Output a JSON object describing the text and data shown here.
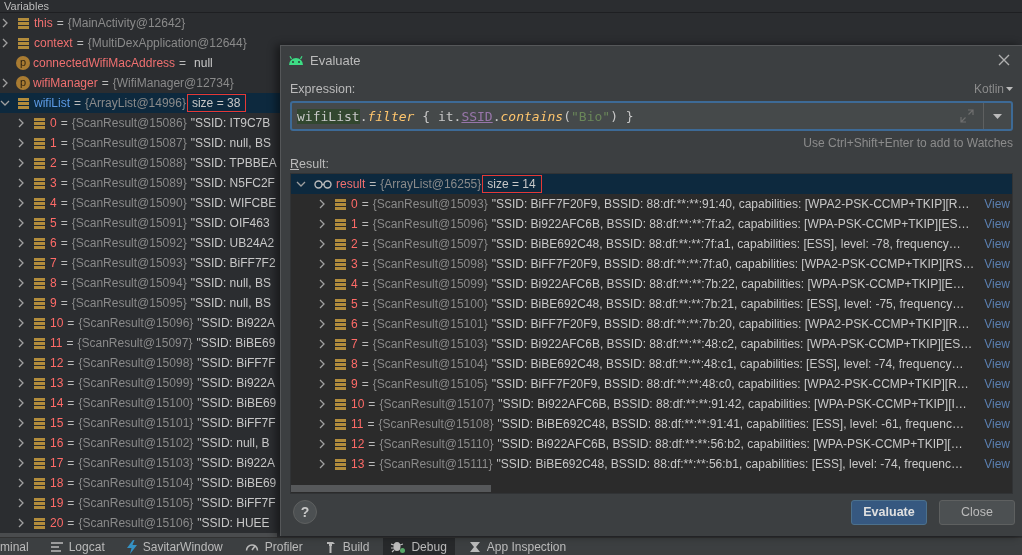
{
  "panel": {
    "title": "Variables"
  },
  "variables": [
    {
      "kind": "field",
      "name": "this",
      "op": "=",
      "type_label": "{MainActivity@12642}",
      "changed": false,
      "expanded": false,
      "selected": false
    },
    {
      "kind": "field",
      "name": "context",
      "op": "=",
      "type_label": "{MultiDexApplication@12644}",
      "changed": false,
      "expanded": false,
      "selected": false
    },
    {
      "kind": "property",
      "icon_letter": "p",
      "name": "connectedWifiMacAddress",
      "op": "=",
      "value": "null",
      "changed": false,
      "selected": false
    },
    {
      "kind": "property",
      "icon_letter": "p",
      "name": "wifiManager",
      "op": "=",
      "type_label": "{WifiManager@12734}",
      "changed": false,
      "expanded": false,
      "selected": false
    },
    {
      "kind": "field",
      "name": "wifiList",
      "op": "=",
      "type_label": "{ArrayList@14996}",
      "size": "size = 38",
      "annotated": true,
      "changed": true,
      "expanded": true,
      "selected": true,
      "children": [
        {
          "kind": "field",
          "name": "0",
          "op": "=",
          "type_label": "{ScanResult@15086}",
          "value": "\"SSID: IT9C7B",
          "expanded": false,
          "selected": false
        },
        {
          "kind": "field",
          "name": "1",
          "op": "=",
          "type_label": "{ScanResult@15087}",
          "value": "\"SSID: null, BS",
          "expanded": false,
          "selected": false
        },
        {
          "kind": "field",
          "name": "2",
          "op": "=",
          "type_label": "{ScanResult@15088}",
          "value": "\"SSID: TPBBEA",
          "expanded": false,
          "selected": false
        },
        {
          "kind": "field",
          "name": "3",
          "op": "=",
          "type_label": "{ScanResult@15089}",
          "value": "\"SSID: N5FC2F",
          "expanded": false,
          "selected": false
        },
        {
          "kind": "field",
          "name": "4",
          "op": "=",
          "type_label": "{ScanResult@15090}",
          "value": "\"SSID: WIFCBE",
          "expanded": false,
          "selected": false
        },
        {
          "kind": "field",
          "name": "5",
          "op": "=",
          "type_label": "{ScanResult@15091}",
          "value": "\"SSID: OIF463",
          "expanded": false,
          "selected": false
        },
        {
          "kind": "field",
          "name": "6",
          "op": "=",
          "type_label": "{ScanResult@15092}",
          "value": "\"SSID: UB24A2",
          "expanded": false,
          "selected": false
        },
        {
          "kind": "field",
          "name": "7",
          "op": "=",
          "type_label": "{ScanResult@15093}",
          "value": "\"SSID: BiFF7F2",
          "expanded": false,
          "selected": false
        },
        {
          "kind": "field",
          "name": "8",
          "op": "=",
          "type_label": "{ScanResult@15094}",
          "value": "\"SSID: null, BS",
          "expanded": false,
          "selected": false
        },
        {
          "kind": "field",
          "name": "9",
          "op": "=",
          "type_label": "{ScanResult@15095}",
          "value": "\"SSID: null, BS",
          "expanded": false,
          "selected": false
        },
        {
          "kind": "field",
          "name": "10",
          "op": "=",
          "type_label": "{ScanResult@15096}",
          "value": "\"SSID: Bi922A",
          "expanded": false,
          "selected": false
        },
        {
          "kind": "field",
          "name": "11",
          "op": "=",
          "type_label": "{ScanResult@15097}",
          "value": "\"SSID: BiBE69",
          "expanded": false,
          "selected": false
        },
        {
          "kind": "field",
          "name": "12",
          "op": "=",
          "type_label": "{ScanResult@15098}",
          "value": "\"SSID: BiFF7F",
          "expanded": false,
          "selected": false
        },
        {
          "kind": "field",
          "name": "13",
          "op": "=",
          "type_label": "{ScanResult@15099}",
          "value": "\"SSID: Bi922A",
          "expanded": false,
          "selected": false
        },
        {
          "kind": "field",
          "name": "14",
          "op": "=",
          "type_label": "{ScanResult@15100}",
          "value": "\"SSID: BiBE69",
          "expanded": false,
          "selected": false
        },
        {
          "kind": "field",
          "name": "15",
          "op": "=",
          "type_label": "{ScanResult@15101}",
          "value": "\"SSID: BiFF7F",
          "expanded": false,
          "selected": false
        },
        {
          "kind": "field",
          "name": "16",
          "op": "=",
          "type_label": "{ScanResult@15102}",
          "value": "\"SSID: null, B",
          "expanded": false,
          "selected": false
        },
        {
          "kind": "field",
          "name": "17",
          "op": "=",
          "type_label": "{ScanResult@15103}",
          "value": "\"SSID: Bi922A",
          "expanded": false,
          "selected": false
        },
        {
          "kind": "field",
          "name": "18",
          "op": "=",
          "type_label": "{ScanResult@15104}",
          "value": "\"SSID: BiBE69",
          "expanded": false,
          "selected": false
        },
        {
          "kind": "field",
          "name": "19",
          "op": "=",
          "type_label": "{ScanResult@15105}",
          "value": "\"SSID: BiFF7F",
          "expanded": false,
          "selected": false
        },
        {
          "kind": "field",
          "name": "20",
          "op": "=",
          "type_label": "{ScanResult@15106}",
          "value": "\"SSID: HUEE",
          "expanded": false,
          "selected": false
        }
      ]
    }
  ],
  "dialog": {
    "title": "Evaluate",
    "expression_label": "Expression:",
    "language": "Kotlin",
    "expression": [
      {
        "text": "wifiList",
        "kind": "highlight"
      },
      {
        "text": ".",
        "kind": "plain"
      },
      {
        "text": "filter",
        "kind": "function"
      },
      {
        "text": " { it.",
        "kind": "plain"
      },
      {
        "text": "SSID",
        "kind": "property"
      },
      {
        "text": ".",
        "kind": "plain"
      },
      {
        "text": "contains",
        "kind": "function"
      },
      {
        "text": "(",
        "kind": "plain"
      },
      {
        "text": "\"Bio\"",
        "kind": "string"
      },
      {
        "text": ") }",
        "kind": "plain"
      }
    ],
    "hint": "Use Ctrl+Shift+Enter to add to Watches",
    "result_label": "Result:",
    "result_label_mnemonic": true,
    "result": {
      "kind": "watch",
      "name": "result",
      "op": "=",
      "type_label": "{ArrayList@16255}",
      "size": "size = 14",
      "annotated": true,
      "expanded": true,
      "selected": true,
      "children": [
        {
          "kind": "field",
          "name": "0",
          "op": "=",
          "type_label": "{ScanResult@15093}",
          "value": "\"SSID: BiFF7F20F9, BSSID: 88:df:**:**:91:40, capabilities: [WPA2-PSK-CCMP+TKIP][R…",
          "link": "View",
          "expanded": false,
          "selected": false
        },
        {
          "kind": "field",
          "name": "1",
          "op": "=",
          "type_label": "{ScanResult@15096}",
          "value": "\"SSID: Bi922AFC6B, BSSID: 88:df:**:**:7f:a2, capabilities: [WPA-PSK-CCMP+TKIP][ES…",
          "link": "View",
          "expanded": false,
          "selected": false
        },
        {
          "kind": "field",
          "name": "2",
          "op": "=",
          "type_label": "{ScanResult@15097}",
          "value": "\"SSID: BiBE692C48, BSSID: 88:df:**:**:7f:a1, capabilities: [ESS], level: -78, frequency…",
          "link": "View",
          "expanded": false,
          "selected": false
        },
        {
          "kind": "field",
          "name": "3",
          "op": "=",
          "type_label": "{ScanResult@15098}",
          "value": "\"SSID: BiFF7F20F9, BSSID: 88:df:**:**:7f:a0, capabilities: [WPA2-PSK-CCMP+TKIP][RS…",
          "link": "View",
          "expanded": false,
          "selected": false
        },
        {
          "kind": "field",
          "name": "4",
          "op": "=",
          "type_label": "{ScanResult@15099}",
          "value": "\"SSID: Bi922AFC6B, BSSID: 88:df:**:**:7b:22, capabilities: [WPA-PSK-CCMP+TKIP][E…",
          "link": "View",
          "expanded": false,
          "selected": false
        },
        {
          "kind": "field",
          "name": "5",
          "op": "=",
          "type_label": "{ScanResult@15100}",
          "value": "\"SSID: BiBE692C48, BSSID: 88:df:**:**:7b:21, capabilities: [ESS], level: -75, frequency…",
          "link": "View",
          "expanded": false,
          "selected": false
        },
        {
          "kind": "field",
          "name": "6",
          "op": "=",
          "type_label": "{ScanResult@15101}",
          "value": "\"SSID: BiFF7F20F9, BSSID: 88:df:**:**:7b:20, capabilities: [WPA2-PSK-CCMP+TKIP][R…",
          "link": "View",
          "expanded": false,
          "selected": false
        },
        {
          "kind": "field",
          "name": "7",
          "op": "=",
          "type_label": "{ScanResult@15103}",
          "value": "\"SSID: Bi922AFC6B, BSSID: 88:df:**:**:48:c2, capabilities: [WPA-PSK-CCMP+TKIP][ES…",
          "link": "View",
          "expanded": false,
          "selected": false
        },
        {
          "kind": "field",
          "name": "8",
          "op": "=",
          "type_label": "{ScanResult@15104}",
          "value": "\"SSID: BiBE692C48, BSSID: 88:df:**:**:48:c1, capabilities: [ESS], level: -74, frequency…",
          "link": "View",
          "expanded": false,
          "selected": false
        },
        {
          "kind": "field",
          "name": "9",
          "op": "=",
          "type_label": "{ScanResult@15105}",
          "value": "\"SSID: BiFF7F20F9, BSSID: 88:df:**:**:48:c0, capabilities: [WPA2-PSK-CCMP+TKIP][R…",
          "link": "View",
          "expanded": false,
          "selected": false
        },
        {
          "kind": "field",
          "name": "10",
          "op": "=",
          "type_label": "{ScanResult@15107}",
          "value": "\"SSID: Bi922AFC6B, BSSID: 88:df:**:**:91:42, capabilities: [WPA-PSK-CCMP+TKIP][I…",
          "link": "View",
          "expanded": false,
          "selected": false
        },
        {
          "kind": "field",
          "name": "11",
          "op": "=",
          "type_label": "{ScanResult@15108}",
          "value": "\"SSID: BiBE692C48, BSSID: 88:df:**:**:91:41, capabilities: [ESS], level: -61, frequenc…",
          "link": "View",
          "expanded": false,
          "selected": false
        },
        {
          "kind": "field",
          "name": "12",
          "op": "=",
          "type_label": "{ScanResult@15110}",
          "value": "\"SSID: Bi922AFC6B, BSSID: 88:df:**:**:56:b2, capabilities: [WPA-PSK-CCMP+TKIP][…",
          "link": "View",
          "expanded": false,
          "selected": false
        },
        {
          "kind": "field",
          "name": "13",
          "op": "=",
          "type_label": "{ScanResult@15111}",
          "value": "\"SSID: BiBE692C48, BSSID: 88:df:**:**:56:b1, capabilities: [ESS], level: -74, frequenc…",
          "link": "View",
          "expanded": false,
          "selected": false
        }
      ]
    },
    "help": "?",
    "buttons": [
      {
        "label": "Evaluate",
        "kind": "primary"
      },
      {
        "label": "Close",
        "kind": "secondary"
      }
    ]
  },
  "tool_bar": [
    {
      "label": "minal",
      "kind": "terminal",
      "selected": false
    },
    {
      "label": "Logcat",
      "kind": "logcat",
      "selected": false
    },
    {
      "label": "SavitarWindow",
      "kind": "plugin",
      "selected": false
    },
    {
      "label": "Profiler",
      "kind": "profiler",
      "selected": false
    },
    {
      "label": "Build",
      "kind": "build",
      "selected": false
    },
    {
      "label": "Debug",
      "kind": "debug",
      "selected": true
    },
    {
      "label": "App Inspection",
      "kind": "inspection",
      "selected": false
    }
  ]
}
